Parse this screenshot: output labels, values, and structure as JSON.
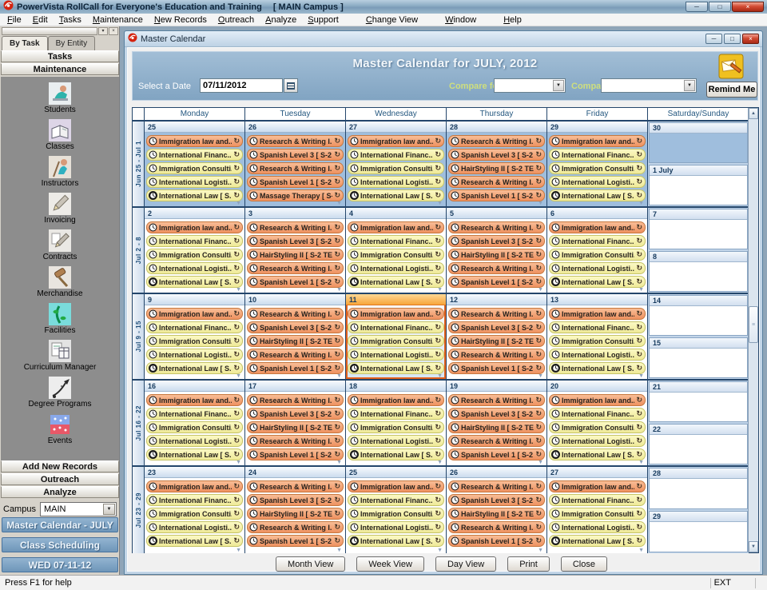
{
  "app": {
    "title": "PowerVista RollCall for Everyone's Education and Training",
    "campus_suffix": "[ MAIN Campus ]",
    "menu": [
      "File",
      "Edit",
      "Tasks",
      "Maintenance",
      "New Records",
      "Outreach",
      "Analyze",
      "Support",
      "Change View",
      "Window",
      "Help"
    ],
    "status_left": "Press F1 for help",
    "status_right": "EXT"
  },
  "sidebar": {
    "tabs": [
      "By Task",
      "By Entity"
    ],
    "active_tab": "By Task",
    "top_bars": [
      "Tasks",
      "Maintenance"
    ],
    "items": [
      {
        "label": "Students",
        "icon": "students-icon"
      },
      {
        "label": "Classes",
        "icon": "classes-icon"
      },
      {
        "label": "Instructors",
        "icon": "instructors-icon"
      },
      {
        "label": "Invoicing",
        "icon": "invoicing-icon"
      },
      {
        "label": "Contracts",
        "icon": "contracts-icon"
      },
      {
        "label": "Merchandise",
        "icon": "merchandise-icon"
      },
      {
        "label": "Facilities",
        "icon": "facilities-icon"
      },
      {
        "label": "Curriculum Manager",
        "icon": "curriculum-manager-icon"
      },
      {
        "label": "Degree Programs",
        "icon": "degree-programs-icon"
      },
      {
        "label": "Events",
        "icon": "events-icon"
      }
    ],
    "bottom_bars": [
      "Add New Records",
      "Outreach",
      "Analyze"
    ],
    "campus_label": "Campus",
    "campus_value": "MAIN",
    "blue_buttons": [
      "Master Calendar - JULY",
      "Class Scheduling",
      "WED 07-11-12"
    ]
  },
  "calendar_window": {
    "title": "Master Calendar",
    "heading": "Master Calendar for JULY, 2012",
    "select_date_label": "Select a Date",
    "select_date_value": "07/11/2012",
    "compare_for_label": "Compare for:",
    "compare_label": "Compare",
    "remind_me_label": "Remind Me",
    "day_headers": [
      "Monday",
      "Tuesday",
      "Wednesday",
      "Thursday",
      "Friday",
      "Saturday/Sunday"
    ],
    "footer_buttons": [
      "Month View",
      "Week View",
      "Day View",
      "Print",
      "Close"
    ],
    "event_patterns": {
      "mon_wed_fri": [
        {
          "title": "Immigration law and...",
          "color": "orange",
          "icon": "clock-icon"
        },
        {
          "title": "International Financ...",
          "color": "yellow",
          "icon": "clock-icon"
        },
        {
          "title": "Immigration Consulti...",
          "color": "yellow",
          "icon": "clock-icon"
        },
        {
          "title": "International Logisti...",
          "color": "yellow",
          "icon": "clock-icon"
        },
        {
          "title": "International Law [ S...",
          "color": "yellow",
          "icon": "clock-bold-icon"
        }
      ],
      "tue_thu": [
        {
          "title": "Research & Writing I...",
          "color": "orange",
          "icon": "clock-icon"
        },
        {
          "title": "Spanish Level 3 [ S-2 ...",
          "color": "orange",
          "icon": "clock-icon"
        },
        {
          "title": "HairStyling II [ S-2 TE...",
          "color": "orange",
          "icon": "clock-icon"
        },
        {
          "title": "Research & Writing I...",
          "color": "orange",
          "icon": "clock-icon"
        },
        {
          "title": "Spanish Level 1 [ S-2 ...",
          "color": "orange",
          "icon": "clock-icon"
        }
      ],
      "tuesday_week1": [
        {
          "title": "Research & Writing I...",
          "color": "orange",
          "icon": "clock-icon"
        },
        {
          "title": "Spanish Level 3 [ S-2 ...",
          "color": "orange",
          "icon": "clock-icon"
        },
        {
          "title": "Research & Writing I...",
          "color": "orange",
          "icon": "clock-icon"
        },
        {
          "title": "Spanish Level 1 [ S-2 ...",
          "color": "orange",
          "icon": "clock-icon"
        },
        {
          "title": "Massage Therapy [ S-...",
          "color": "orange",
          "icon": "clock-icon"
        }
      ]
    },
    "weeks": [
      {
        "label": "Jun 25 - Jul 1",
        "days": [
          {
            "num": "25",
            "month": "june",
            "pattern": "mon_wed_fri"
          },
          {
            "num": "26",
            "month": "june",
            "pattern": "tuesday_week1"
          },
          {
            "num": "27",
            "month": "june",
            "pattern": "mon_wed_fri"
          },
          {
            "num": "28",
            "month": "june",
            "pattern": "tue_thu"
          },
          {
            "num": "29",
            "month": "june",
            "pattern": "mon_wed_fri"
          }
        ],
        "weekend": [
          {
            "num": "30",
            "month": "june"
          },
          {
            "num": "1 July"
          }
        ]
      },
      {
        "label": "Jul 2 - 8",
        "days": [
          {
            "num": "2",
            "pattern": "mon_wed_fri"
          },
          {
            "num": "3",
            "pattern": "tue_thu"
          },
          {
            "num": "4",
            "pattern": "mon_wed_fri"
          },
          {
            "num": "5",
            "pattern": "tue_thu"
          },
          {
            "num": "6",
            "pattern": "mon_wed_fri"
          }
        ],
        "weekend": [
          {
            "num": "7"
          },
          {
            "num": "8"
          }
        ]
      },
      {
        "label": "Jul 9 - 15",
        "days": [
          {
            "num": "9",
            "pattern": "mon_wed_fri"
          },
          {
            "num": "10",
            "pattern": "tue_thu"
          },
          {
            "num": "11",
            "pattern": "mon_wed_fri",
            "today": true
          },
          {
            "num": "12",
            "pattern": "tue_thu"
          },
          {
            "num": "13",
            "pattern": "mon_wed_fri"
          }
        ],
        "weekend": [
          {
            "num": "14"
          },
          {
            "num": "15"
          }
        ]
      },
      {
        "label": "Jul 16 - 22",
        "days": [
          {
            "num": "16",
            "pattern": "mon_wed_fri"
          },
          {
            "num": "17",
            "pattern": "tue_thu"
          },
          {
            "num": "18",
            "pattern": "mon_wed_fri"
          },
          {
            "num": "19",
            "pattern": "tue_thu"
          },
          {
            "num": "20",
            "pattern": "mon_wed_fri"
          }
        ],
        "weekend": [
          {
            "num": "21"
          },
          {
            "num": "22"
          }
        ]
      },
      {
        "label": "Jul 23 - 29",
        "days": [
          {
            "num": "23",
            "pattern": "mon_wed_fri"
          },
          {
            "num": "24",
            "pattern": "tue_thu"
          },
          {
            "num": "25",
            "pattern": "mon_wed_fri"
          },
          {
            "num": "26",
            "pattern": "tue_thu"
          },
          {
            "num": "27",
            "pattern": "mon_wed_fri"
          }
        ],
        "weekend": [
          {
            "num": "28"
          },
          {
            "num": "29"
          }
        ]
      }
    ]
  },
  "colors": {
    "event_orange": "#EE9160",
    "event_yellow": "#EFE998",
    "out_of_month_blue": "#9FBEDD",
    "today_highlight": "#F7A53A",
    "header_panel_blue": "#8FAFC9",
    "sidebar_button_blue": "#7FA5C6"
  }
}
